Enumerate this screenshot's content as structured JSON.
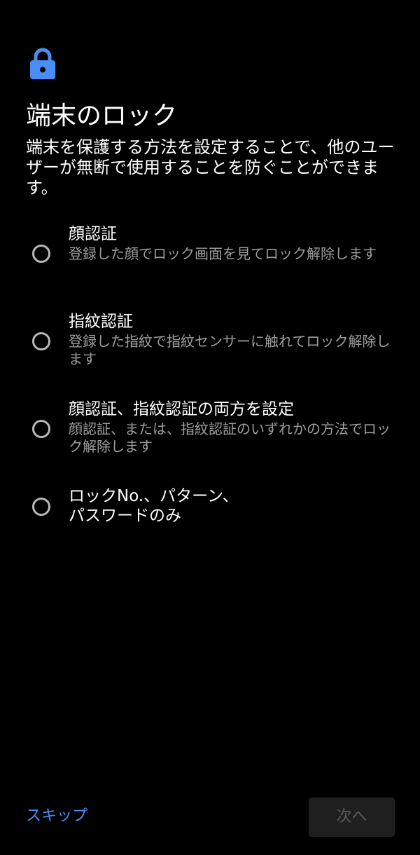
{
  "colors": {
    "background": "#000000",
    "accent": "#4a8ef5",
    "text_primary": "#ffffff",
    "text_secondary": "#9e9e9e",
    "radio_border": "#b8b8b8",
    "disabled_button_bg": "#1f1f1f",
    "disabled_button_text": "#5a5a5a"
  },
  "header": {
    "icon": "lock-icon",
    "title": "端末のロック",
    "description": "端末を保護する方法を設定することで、他のユーザーが無断で使用することを防ぐことができます。"
  },
  "options": [
    {
      "title": "顔認証",
      "subtitle": "登録した顔でロック画面を見てロック解除します",
      "selected": false
    },
    {
      "title": "指紋認証",
      "subtitle": "登録した指紋で指紋センサーに触れてロック解除します",
      "selected": false
    },
    {
      "title": "顔認証、指紋認証の両方を設定",
      "subtitle": "顔認証、または、指紋認証のいずれかの方法でロック解除します",
      "selected": false
    },
    {
      "title": "ロックNo.、パターン、パスワードのみ",
      "subtitle": "",
      "selected": false
    }
  ],
  "footer": {
    "skip_label": "スキップ",
    "next_label": "次へ",
    "next_enabled": false
  }
}
